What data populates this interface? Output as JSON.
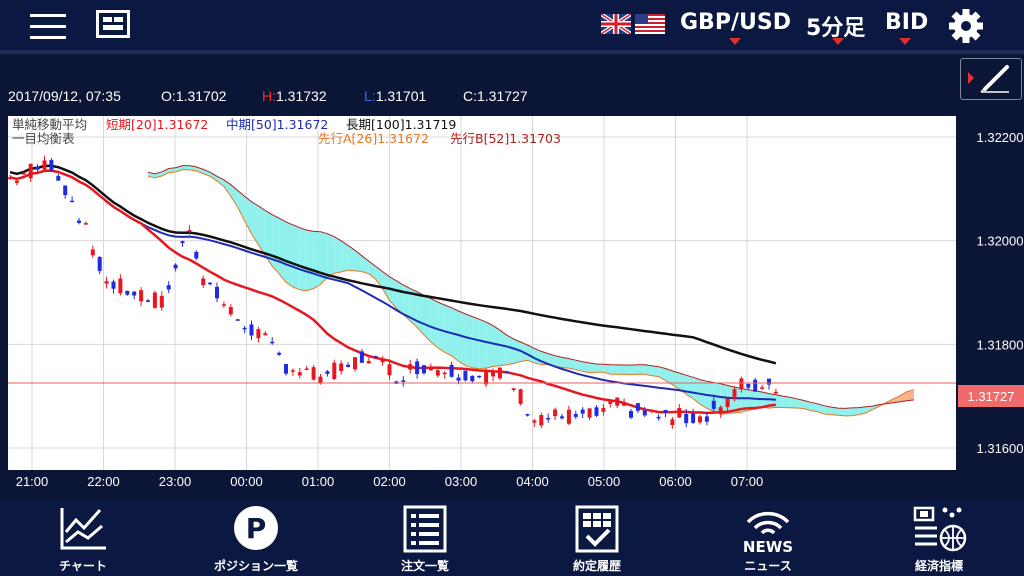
{
  "header": {
    "pair": "GBP/USD",
    "timeframe": "5分足",
    "side": "BID"
  },
  "info": {
    "datetime": "2017/09/12, 07:35",
    "open": "O:1.31702",
    "high_label": "H:",
    "high_value": "1.31732",
    "low_label": "L:",
    "low_value": "1.31701",
    "close": "C:1.31727"
  },
  "legend": {
    "sma_title": "単純移動平均",
    "sma_short": "短期[20]1.31672",
    "sma_mid": "中期[50]1.31672",
    "sma_long": "長期[100]1.31719",
    "ichimoku_title": "一目均衡表",
    "span_a": "先行A[26]1.31672",
    "span_b": "先行B[52]1.31703"
  },
  "chart_data": {
    "type": "candlestick",
    "y_ticks": [
      "1.32200",
      "1.32000",
      "1.31800",
      "1.31600"
    ],
    "ylim": [
      1.3154,
      1.3226
    ],
    "x_ticks": [
      "21:00",
      "22:00",
      "23:00",
      "00:00",
      "01:00",
      "02:00",
      "03:00",
      "04:00",
      "05:00",
      "06:00",
      "07:00"
    ],
    "current_price": "1.31727",
    "colors": {
      "up": "#e8171f",
      "down": "#1f2be0",
      "sma_short": "#e8171f",
      "sma_mid": "#1f2bb0",
      "sma_long": "#111111",
      "span_a": "#e87722",
      "span_b": "#b02020",
      "cloud_bull": "#f5b48c",
      "cloud_bear": "#8ff0ec",
      "price_line": "#e86060",
      "current_price_bg": "#f06a6a"
    }
  },
  "nav": [
    {
      "label": "チャート",
      "icon": "chart-icon"
    },
    {
      "label": "ポジション一覧",
      "icon": "position-icon"
    },
    {
      "label": "注文一覧",
      "icon": "order-list-icon"
    },
    {
      "label": "約定履歴",
      "icon": "execution-history-icon"
    },
    {
      "label": "ニュース",
      "icon": "news-icon",
      "icon_text": "NEWS"
    },
    {
      "label": "経済指標",
      "icon": "economic-indicator-icon"
    }
  ]
}
